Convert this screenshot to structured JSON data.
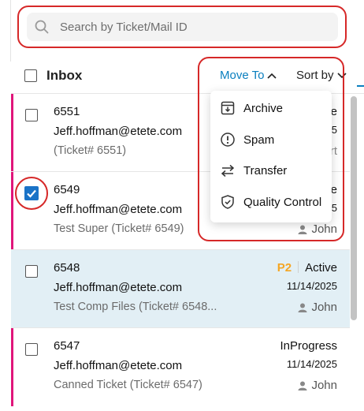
{
  "search": {
    "placeholder": "Search by Ticket/Mail ID"
  },
  "header": {
    "inbox_label": "Inbox",
    "move_to_label": "Move To",
    "sort_by_label": "Sort by"
  },
  "move_menu": {
    "items": [
      "Archive",
      "Spam",
      "Transfer",
      "Quality Control"
    ]
  },
  "tickets": [
    {
      "id": "6551",
      "email": "Jeff.hoffman@etete.com",
      "subject": "(Ticket# 6551)",
      "status_partial": "e",
      "date_partial": "5",
      "agent_partial": "rt",
      "checked": false
    },
    {
      "id": "6549",
      "email": "Jeff.hoffman@etete.com",
      "subject": "Test Super (Ticket# 6549)",
      "status_partial": "e",
      "date_partial": "5",
      "agent": "John",
      "checked": true
    },
    {
      "id": "6548",
      "email": "Jeff.hoffman@etete.com",
      "subject": "Test Comp Files (Ticket# 6548...",
      "priority": "P2",
      "status": "Active",
      "date": "11/14/2025",
      "agent": "John",
      "checked": false,
      "selected": true
    },
    {
      "id": "6547",
      "email": "Jeff.hoffman@etete.com",
      "subject": "Canned Ticket (Ticket# 6547)",
      "status": "InProgress",
      "date": "11/14/2025",
      "agent": "John",
      "checked": false
    }
  ],
  "colors": {
    "accent_pink": "#e0157a",
    "link_blue": "#0a7fbf",
    "priority_orange": "#f5a623",
    "selected_row_bg": "#e2eff5",
    "annotation_red": "#d62828"
  }
}
